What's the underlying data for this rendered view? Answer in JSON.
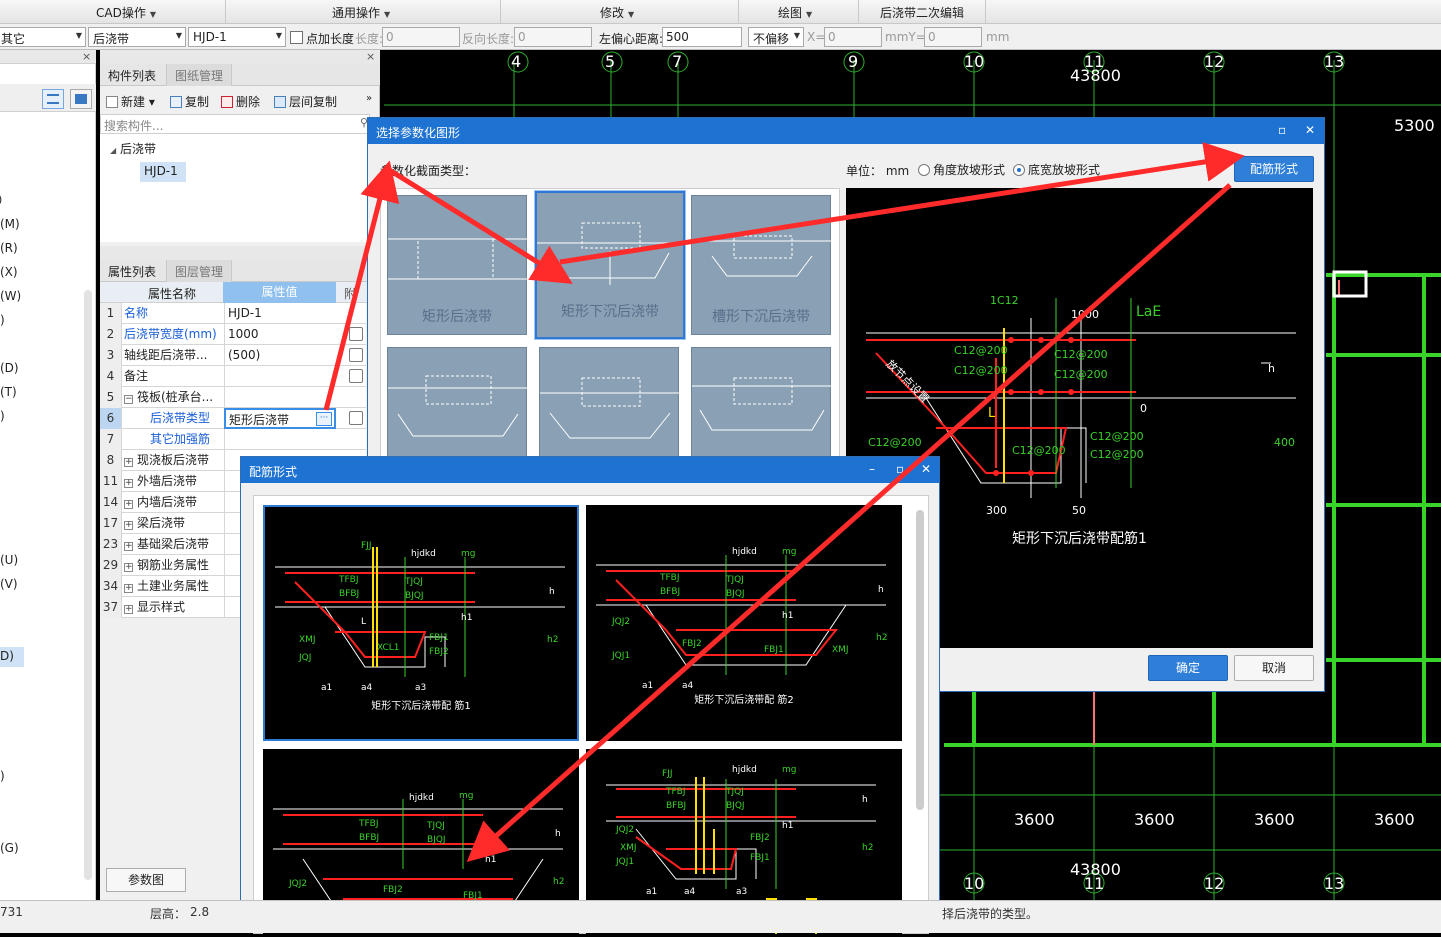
{
  "menubar": {
    "items": [
      "CAD操作",
      "通用操作",
      "修改",
      "绘图",
      "后浇带二次编辑"
    ]
  },
  "toolbar": {
    "combo1": "其它",
    "combo2": "后浇带",
    "combo3": "HJD-1",
    "add_length_label": "点加长度",
    "length_label": "长度:",
    "length_value": "0",
    "reverse_label": "反向长度:",
    "reverse_value": "0",
    "left_offset_label": "左偏心距离:",
    "left_offset_value": "500",
    "no_offset": "不偏移",
    "x_label": "X=",
    "x_value": "0",
    "mmy_label": "mmY=",
    "y_value": "0",
    "mm_label": "mm"
  },
  "leftnav": {
    "items": [
      "(M)",
      "(R)",
      "(X)",
      "(W)",
      ")",
      "(D)",
      "(T)",
      ")",
      "(U)",
      "(V)",
      "D)",
      ")",
      "(G)"
    ],
    "bottom": "731"
  },
  "component_panel": {
    "tab_active": "构件列表",
    "tab_inactive": "图纸管理",
    "new_label": "新建",
    "copy_label": "复制",
    "delete_label": "删除",
    "floor_copy_label": "层间复制",
    "search_placeholder": "搜索构件...",
    "tree_root": "后浇带",
    "tree_child": "HJD-1"
  },
  "property_panel": {
    "tab_active": "属性列表",
    "tab_inactive": "图层管理",
    "col_name": "属性名称",
    "col_value": "属性值",
    "col_add": "附加",
    "rows": [
      {
        "n": "1",
        "k": "名称",
        "v": "HJD-1",
        "blue": true,
        "chk": false
      },
      {
        "n": "2",
        "k": "后浇带宽度(mm)",
        "v": "1000",
        "blue": true,
        "chk": true
      },
      {
        "n": "3",
        "k": "轴线距后浇带...",
        "v": "(500)",
        "blue": false,
        "chk": true
      },
      {
        "n": "4",
        "k": "备注",
        "v": "",
        "blue": false,
        "chk": true
      },
      {
        "n": "5",
        "k": "筏板(桩承台...",
        "v": "",
        "blue": false,
        "chk": false,
        "minus": true
      },
      {
        "n": "6",
        "k": "后浇带类型",
        "v": "矩形后浇带",
        "blue": true,
        "chk": true,
        "sel": true
      },
      {
        "n": "7",
        "k": "其它加强筋",
        "v": "",
        "blue": true,
        "chk": false
      },
      {
        "n": "8",
        "k": "现浇板后浇带",
        "v": "",
        "plus": true
      },
      {
        "n": "11",
        "k": "外墙后浇带",
        "v": "",
        "plus": true
      },
      {
        "n": "14",
        "k": "内墙后浇带",
        "v": "",
        "plus": true
      },
      {
        "n": "17",
        "k": "梁后浇带",
        "v": "",
        "plus": true
      },
      {
        "n": "23",
        "k": "基础梁后浇带",
        "v": "",
        "plus": true
      },
      {
        "n": "29",
        "k": "钢筋业务属性",
        "v": "",
        "plus": true
      },
      {
        "n": "34",
        "k": "土建业务属性",
        "v": "",
        "plus": true
      },
      {
        "n": "37",
        "k": "显示样式",
        "v": "",
        "plus": true
      }
    ],
    "param_button": "参数图"
  },
  "status": {
    "floor_height": "层高：",
    "floor_value": "2.8",
    "hint": "择后浇带的类型。"
  },
  "cad": {
    "axis_top": [
      "4",
      "5",
      "7",
      "9",
      "10",
      "11",
      "12",
      "13"
    ],
    "axis_bottom": [
      "10",
      "11",
      "12",
      "13"
    ],
    "dim_top": "43800",
    "dim_right": "5300",
    "dim_bottom": "43800",
    "spans": [
      "3600",
      "3600",
      "3600",
      "3600"
    ]
  },
  "dialog_param": {
    "title": "选择参数化图形",
    "section_type_label": "参数化截面类型：",
    "unit_label": "单位：",
    "unit_value": "mm",
    "radio_angle": "角度放坡形式",
    "radio_width": "底宽放坡形式",
    "rebar_button": "配筋形式",
    "thumbs": [
      "矩形后浇带",
      "矩形下沉后浇带",
      "槽形下沉后浇带"
    ],
    "preview_title": "矩形下沉后浇带配筋1",
    "preview_labels": {
      "c1": "1C12",
      "w": "1000",
      "lae": "LaE",
      "h": "h",
      "l": "L",
      "d400": "400",
      "d300": "300",
      "d50": "50",
      "d0": "0",
      "slope": "放节点设置"
    },
    "rebars": [
      "C12@200",
      "C12@200",
      "C12@200",
      "C12@200",
      "C12@200",
      "C12@200",
      "C12@200",
      "C12@200"
    ],
    "ok": "确定",
    "cancel": "取消"
  },
  "dialog_rebar": {
    "title": "配筋形式",
    "items": [
      {
        "label": "矩形下沉后浇带配 筋1"
      },
      {
        "label": "矩形下沉后浇带配 筋2"
      },
      {
        "label": ""
      },
      {
        "label": ""
      }
    ],
    "tags": {
      "fjj": "FJJ",
      "hjdkd": "hjdkd",
      "mg": "mg",
      "tfbj": "TFBJ",
      "bfbj": "BFBJ",
      "tjqj": "TJQJ",
      "bjqj": "BJQJ",
      "h": "h",
      "h1": "h1",
      "h2": "h2",
      "xmj": "XMJ",
      "jqj": "JQJ",
      "jqj1": "JQJ1",
      "jqj2": "JQJ2",
      "fbj1": "FBJ1",
      "fbj2": "FBJ2",
      "l": "L",
      "xcl1": "XCL1",
      "a1": "a1",
      "a3": "a3",
      "a4": "a4",
      "slope": "放节点设置"
    }
  },
  "colors": {
    "accent": "#1e72d1",
    "arrow": "#ff2a2a",
    "rebar": "#ff2020",
    "cad_green": "#39d42a"
  }
}
